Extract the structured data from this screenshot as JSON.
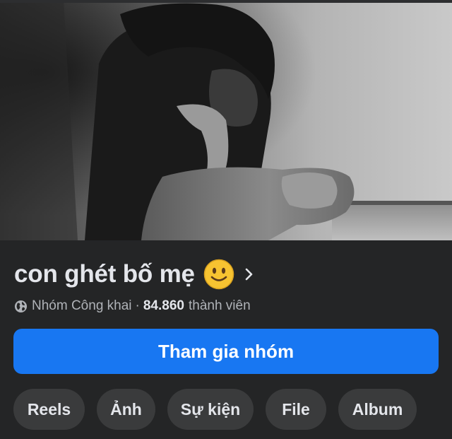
{
  "group": {
    "name": "con ghét bố mẹ",
    "name_emoji": "slightly-smiling-face",
    "privacy_label": "Nhóm Công khai",
    "separator": "·",
    "member_count": "84.860",
    "member_label": "thành viên"
  },
  "actions": {
    "join_label": "Tham gia nhóm"
  },
  "tabs": [
    {
      "label": "Reels"
    },
    {
      "label": "Ảnh"
    },
    {
      "label": "Sự kiện"
    },
    {
      "label": "File"
    },
    {
      "label": "Album"
    }
  ],
  "colors": {
    "background": "#242526",
    "primary_button": "#1877f2",
    "tab_background": "#3a3b3c",
    "text_primary": "#e4e6eb",
    "text_secondary": "#b0b3b8"
  },
  "icons": {
    "privacy": "globe-icon",
    "chevron": "chevron-right-icon"
  }
}
